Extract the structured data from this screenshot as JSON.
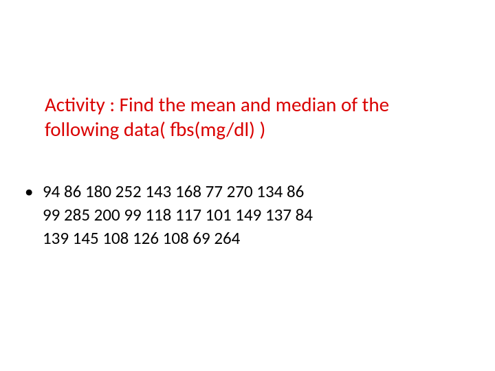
{
  "title": "Activity : Find the mean and median of the following data( fbs(mg/dl) )",
  "bullet_glyph": "•",
  "data_line1": "94 86 180 252 143 168 77 270 134   86",
  "data_line2": "99 285 200 99 118 117 101 149 137 84",
  "data_line3": "139 145 108 126 108 69 264"
}
